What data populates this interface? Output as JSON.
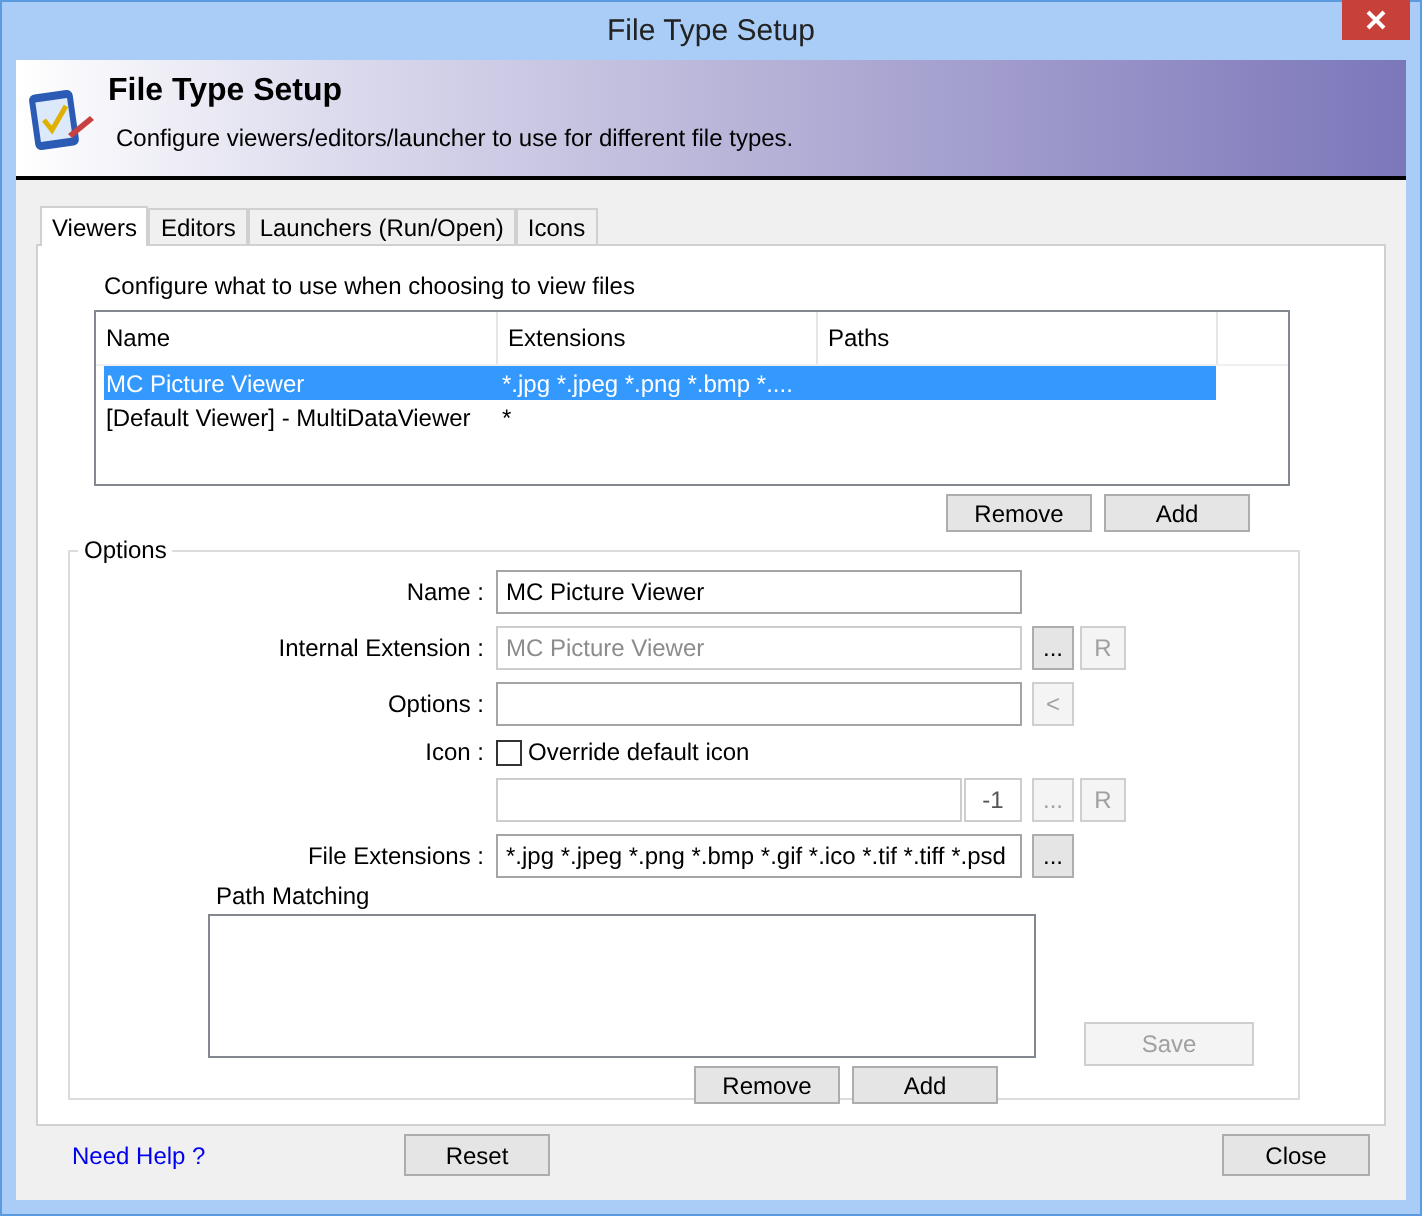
{
  "window": {
    "title": "File Type Setup"
  },
  "header": {
    "title": "File Type Setup",
    "subtitle": "Configure viewers/editors/launcher to use for different file types."
  },
  "tabs": [
    {
      "label": "Viewers",
      "selected": true
    },
    {
      "label": "Editors",
      "selected": false
    },
    {
      "label": "Launchers (Run/Open)",
      "selected": false
    },
    {
      "label": "Icons",
      "selected": false
    }
  ],
  "viewers": {
    "caption": "Configure what to use when choosing to view files",
    "columns": [
      "Name",
      "Extensions",
      "Paths"
    ],
    "rows": [
      {
        "name": "MC Picture Viewer",
        "extensions": "*.jpg *.jpeg *.png *.bmp *....",
        "selected": true
      },
      {
        "name": "[Default Viewer] - MultiDataViewer",
        "extensions": "*",
        "selected": false
      }
    ],
    "buttons": [
      "Remove",
      "Add"
    ]
  },
  "options": {
    "title": "Options",
    "fields": [
      {
        "kind": "text",
        "label": "Name :",
        "value": "MC Picture Viewer",
        "disabled": false
      },
      {
        "kind": "text",
        "label": "Internal Extension :",
        "value": "MC Picture Viewer",
        "disabled": true,
        "buttons": [
          {
            "label": "...",
            "disabled": false
          },
          {
            "label": "R",
            "disabled": true
          }
        ]
      },
      {
        "kind": "text",
        "label": "Options :",
        "disabled": false,
        "buttons": [
          {
            "label": "<",
            "disabled": true
          }
        ]
      },
      {
        "kind": "checkbox",
        "label": "Icon :",
        "text": "Override default icon",
        "checked": false
      },
      {
        "kind": "icon_path",
        "index": "-1",
        "disabled": true,
        "buttons": [
          {
            "label": "...",
            "disabled": true
          },
          {
            "label": "R",
            "disabled": true
          }
        ]
      },
      {
        "kind": "text",
        "label": "File Extensions :",
        "value": "*.jpg *.jpeg *.png *.bmp *.gif *.ico *.tif *.tiff *.psd",
        "disabled": false,
        "buttons": [
          {
            "label": "...",
            "disabled": false
          }
        ]
      }
    ],
    "path_matching": {
      "label": "Path Matching",
      "buttons": [
        "Remove",
        "Add"
      ]
    },
    "save": {
      "label": "Save",
      "disabled": true
    }
  },
  "footer": {
    "help_link": "Need Help ?",
    "buttons": [
      "Reset",
      "Close"
    ]
  }
}
